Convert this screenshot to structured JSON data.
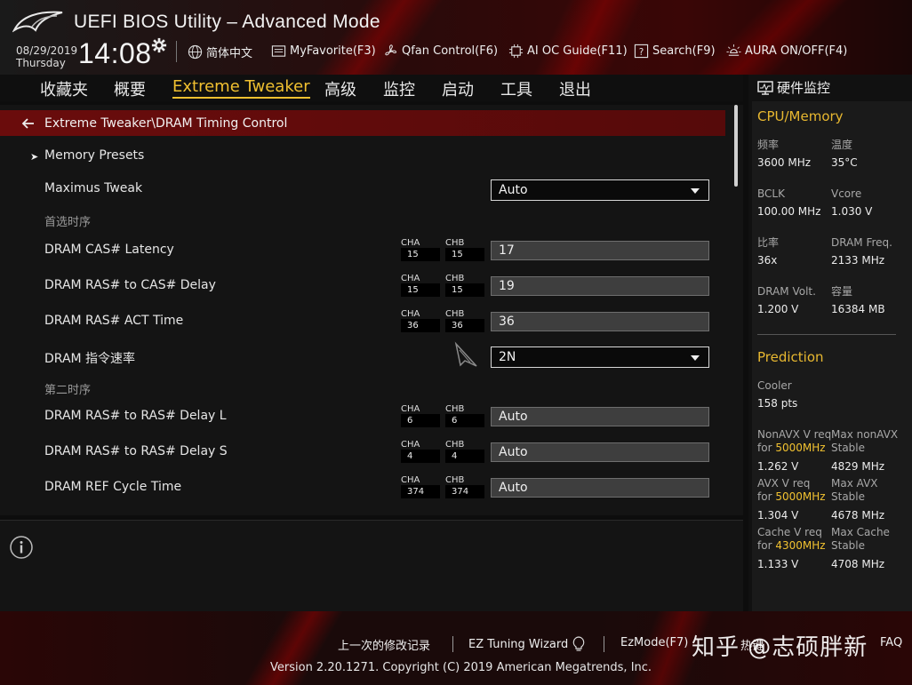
{
  "header": {
    "title": "UEFI BIOS Utility – Advanced Mode",
    "date": "08/29/2019",
    "day": "Thursday",
    "time": "14:08",
    "buttons": [
      {
        "label": "简体中文",
        "icon": "globe-icon"
      },
      {
        "label": "MyFavorite(F3)",
        "icon": "favorites-icon"
      },
      {
        "label": "Qfan Control(F6)",
        "icon": "fan-icon"
      },
      {
        "label": "AI OC Guide(F11)",
        "icon": "chip-icon"
      },
      {
        "label": "Search(F9)",
        "icon": "help-search-icon"
      },
      {
        "label": "AURA ON/OFF(F4)",
        "icon": "aura-light-icon"
      }
    ]
  },
  "tabs": [
    {
      "label": "收藏夹"
    },
    {
      "label": "概要"
    },
    {
      "label": "Extreme Tweaker",
      "active": true
    },
    {
      "label": "高级"
    },
    {
      "label": "监控"
    },
    {
      "label": "启动"
    },
    {
      "label": "工具"
    },
    {
      "label": "退出"
    }
  ],
  "main": {
    "breadcrumb": "Extreme Tweaker\\DRAM Timing Control",
    "memory_presets": "Memory Presets",
    "maximus_tweak": {
      "label": "Maximus Tweak",
      "value": "Auto"
    },
    "primary_section": "首选时序",
    "secondary_section": "第二时序",
    "ch_a_label": "CHA",
    "ch_b_label": "CHB",
    "timings": [
      {
        "label": "DRAM CAS# Latency",
        "cha": "15",
        "chb": "15",
        "value": "17"
      },
      {
        "label": "DRAM RAS# to CAS# Delay",
        "cha": "15",
        "chb": "15",
        "value": "19"
      },
      {
        "label": "DRAM RAS# ACT Time",
        "cha": "36",
        "chb": "36",
        "value": "36"
      }
    ],
    "command_rate": {
      "label": "DRAM 指令速率",
      "value": "2N"
    },
    "secondary": [
      {
        "label": "DRAM RAS# to RAS# Delay L",
        "cha": "6",
        "chb": "6",
        "value": "Auto"
      },
      {
        "label": "DRAM RAS# to RAS# Delay S",
        "cha": "4",
        "chb": "4",
        "value": "Auto"
      },
      {
        "label": "DRAM REF Cycle Time",
        "cha": "374",
        "chb": "374",
        "value": "Auto"
      }
    ]
  },
  "sidebar": {
    "title": "硬件监控",
    "cpu_memory": {
      "heading": "CPU/Memory",
      "freq_label": "频率",
      "freq": "3600 MHz",
      "temp_label": "温度",
      "temp": "35°C",
      "bclk_label": "BCLK",
      "bclk": "100.00 MHz",
      "vcore_label": "Vcore",
      "vcore": "1.030 V",
      "ratio_label": "比率",
      "ratio": "36x",
      "dram_freq_label": "DRAM Freq.",
      "dram_freq": "2133 MHz",
      "dram_volt_label": "DRAM Volt.",
      "dram_volt": "1.200 V",
      "capacity_label": "容量",
      "capacity": "16384 MB"
    },
    "prediction": {
      "heading": "Prediction",
      "cooler_label": "Cooler",
      "cooler": "158 pts",
      "nonavx_req_a": "NonAVX V req",
      "nonavx_req_b": "for",
      "nonavx_freq": "5000MHz",
      "nonavx_v": "1.262 V",
      "max_nonavx_a": "Max nonAVX",
      "max_nonavx_b": "Stable",
      "max_nonavx": "4829 MHz",
      "avx_req_a": "AVX V req",
      "avx_req_b": "for",
      "avx_freq": "5000MHz",
      "avx_v": "1.304 V",
      "max_avx_a": "Max AVX",
      "max_avx_b": "Stable",
      "max_avx": "4678 MHz",
      "cache_req_a": "Cache V req",
      "cache_req_b": "for",
      "cache_freq": "4300MHz",
      "cache_v": "1.133 V",
      "max_cache_a": "Max Cache",
      "max_cache_b": "Stable",
      "max_cache": "4708 MHz"
    }
  },
  "footer": {
    "last_modified": "上一次的修改记录",
    "ez_tuning": "EZ Tuning Wizard",
    "ez_mode": "EzMode(F7)",
    "hotkeys": "热键",
    "faq": "FAQ",
    "copyright": "Version 2.20.1271. Copyright (C) 2019 American Megatrends, Inc.",
    "watermark": "知乎 @志硕胖新"
  },
  "colors": {
    "accent": "#f0c030",
    "breadcrumb_bg": "#6a0c0c",
    "highlight_freq": "#f2c230"
  }
}
